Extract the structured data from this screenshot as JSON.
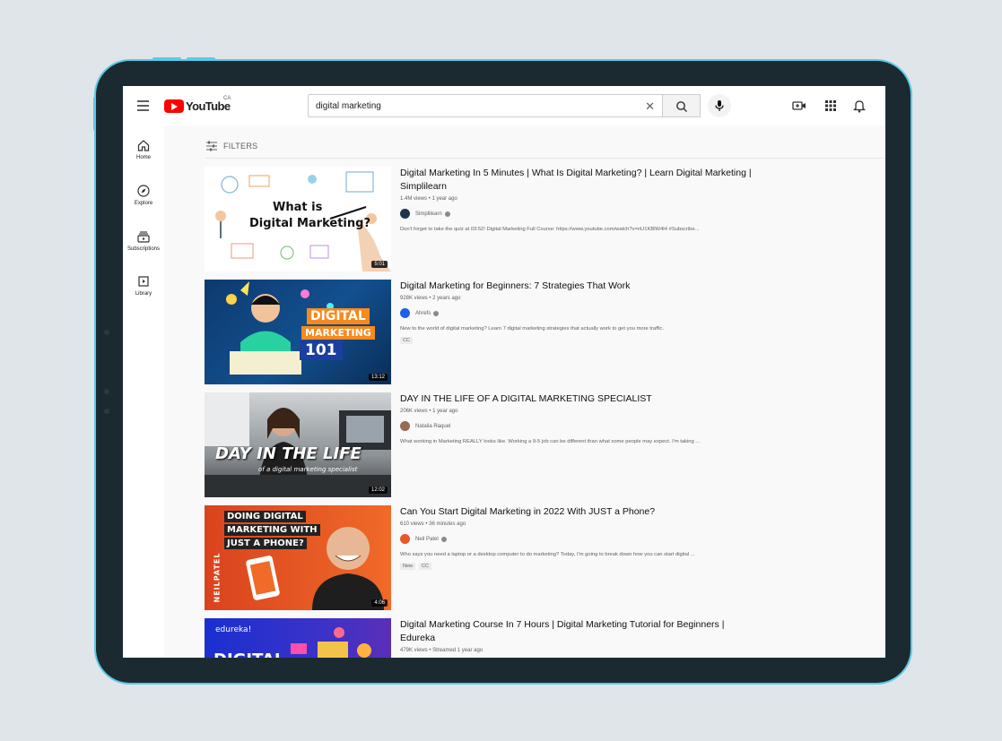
{
  "app": {
    "logo_text": "YouTube",
    "logo_region": "CA"
  },
  "search": {
    "query": "digital marketing"
  },
  "sidebar": {
    "items": [
      {
        "label": "Home",
        "icon": "home-icon"
      },
      {
        "label": "Explore",
        "icon": "compass-icon"
      },
      {
        "label": "Subscriptions",
        "icon": "subscriptions-icon"
      },
      {
        "label": "Library",
        "icon": "library-icon"
      }
    ]
  },
  "filters": {
    "label": "FILTERS"
  },
  "results": [
    {
      "title_line1": "Digital Marketing In 5 Minutes | What Is Digital Marketing? | Learn Digital Marketing |",
      "title_line2": "Simplilearn",
      "meta": "1.4M views • 1 year ago",
      "channel": "Simplilearn",
      "description": "Don't forget to take the quiz at 03:52! Digital Marketing Full Course: https://www.youtube.com/watch?v=nU1KBlW4I4 #Subscribe...",
      "duration": "5:01",
      "thumb_text_1": "What is",
      "thumb_text_2": "Digital Marketing?",
      "badges": []
    },
    {
      "title_line1": "Digital Marketing for Beginners: 7 Strategies That Work",
      "title_line2": "",
      "meta": "928K views • 2 years ago",
      "channel": "Ahrefs",
      "description": "New to the world of digital marketing? Learn 7 digital marketing strategies that actually work to get you more traffic.",
      "duration": "13:12",
      "thumb_text_1": "DIGITAL",
      "thumb_text_2": "MARKETING",
      "thumb_text_3": "101",
      "badges": [
        "CC"
      ]
    },
    {
      "title_line1": "DAY IN THE LIFE OF A DIGITAL MARKETING SPECIALIST",
      "title_line2": "",
      "meta": "206K views • 1 year ago",
      "channel": "Natalia Raquel",
      "description": "What working in Marketing REALLY looks like. Working a 9-5 job can be different than what some people may expect. I'm taking ...",
      "duration": "12:02",
      "thumb_text_1": "DAY IN THE LIFE",
      "thumb_text_2": "of a digital marketing specialist",
      "badges": []
    },
    {
      "title_line1": "Can You Start Digital Marketing in 2022 With JUST a Phone?",
      "title_line2": "",
      "meta": "610 views • 36 minutes ago",
      "channel": "Neil Patel",
      "description": "Who says you need a laptop or a desktop computer to do marketing? Today, I'm going to break down how you can start digital ...",
      "duration": "4:06",
      "thumb_text_1": "DOING DIGITAL",
      "thumb_text_2": "MARKETING WITH",
      "thumb_text_3": "JUST A PHONE?",
      "thumb_text_4": "NEILPATEL",
      "badges": [
        "New",
        "CC"
      ]
    },
    {
      "title_line1": "Digital Marketing Course In 7 Hours | Digital Marketing Tutorial for Beginners |",
      "title_line2": "Edureka",
      "meta": "479K views • Streamed 1 year ago",
      "channel": "",
      "description": "",
      "duration": "",
      "thumb_text_1": "edureka!",
      "thumb_text_2": "DIGITAL",
      "badges": []
    }
  ],
  "colors": {
    "brand_red": "#ff0000",
    "tablet_frame": "#1b2a30",
    "tablet_accent": "#5bc8e8",
    "background": "#dfe5e8"
  }
}
